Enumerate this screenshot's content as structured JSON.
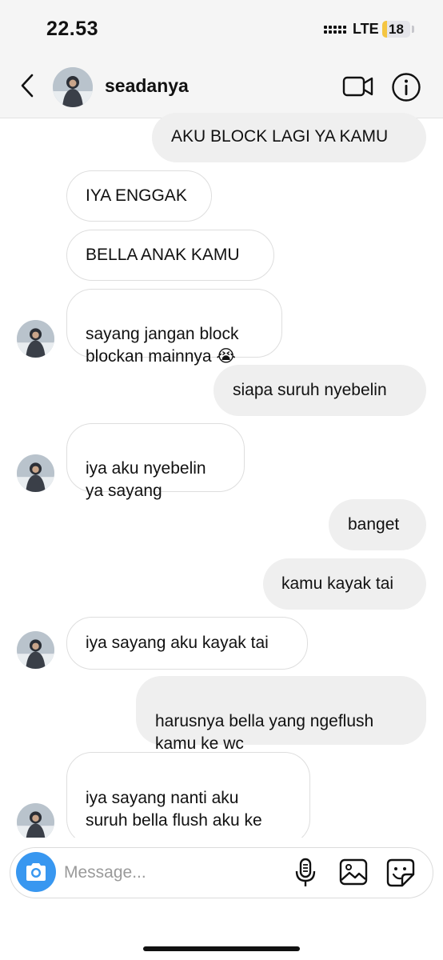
{
  "status_bar": {
    "time": "22.53",
    "network": "LTE",
    "battery_level": "18",
    "battery_fraction": 0.18,
    "battery_color": "#f4c542",
    "signal_icon": "cellular-signal-icon"
  },
  "header": {
    "username": "seadanya",
    "back_icon": "chevron-left-icon",
    "video_icon": "video-call-icon",
    "info_icon": "info-icon"
  },
  "messages": [
    {
      "side": "sent",
      "text": "AKU BLOCK LAGI YA KAMU"
    },
    {
      "side": "received",
      "text": "IYA ENGGAK"
    },
    {
      "side": "received",
      "text": "BELLA ANAK KAMU"
    },
    {
      "side": "received",
      "text": "sayang jangan block\nblockan mainnya 😭"
    },
    {
      "side": "sent",
      "text": "siapa suruh nyebelin"
    },
    {
      "side": "received",
      "text": "iya aku nyebelin\nya sayang"
    },
    {
      "side": "sent",
      "text": "banget"
    },
    {
      "side": "sent",
      "text": "kamu kayak tai"
    },
    {
      "side": "received",
      "text": "iya sayang aku kayak tai"
    },
    {
      "side": "sent",
      "text": "harusnya bella yang ngeflush\nkamu ke wc"
    },
    {
      "side": "received",
      "text": "iya sayang nanti aku\nsuruh bella flush aku ke\nwc ya"
    }
  ],
  "composer": {
    "placeholder": "Message...",
    "camera_icon": "camera-icon",
    "mic_icon": "microphone-icon",
    "gallery_icon": "gallery-icon",
    "sticker_icon": "sticker-icon",
    "accent_color": "#3897f0"
  }
}
